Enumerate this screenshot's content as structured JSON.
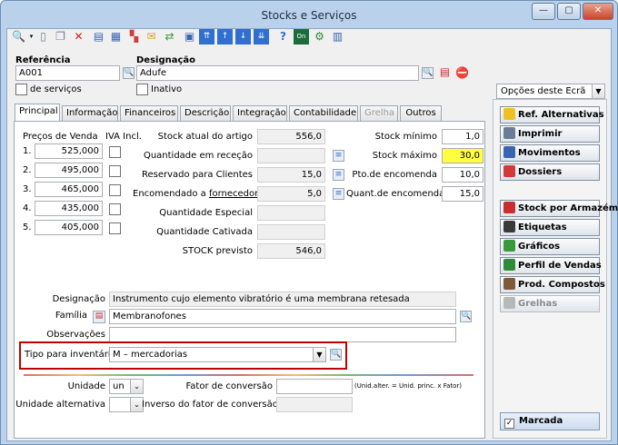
{
  "window": {
    "title": "Stocks e Serviços"
  },
  "header": {
    "ref_label": "Referência",
    "ref_value": "A001",
    "desig_label": "Designação",
    "desig_value": "Adufe",
    "servicos_label": "de serviços",
    "inativo_label": "Inativo"
  },
  "options_select": {
    "value": "Opções deste Ecrã"
  },
  "tabs": [
    {
      "label": "Principal"
    },
    {
      "label": "Informação"
    },
    {
      "label": "Financeiros"
    },
    {
      "label": "Descrição"
    },
    {
      "label": "Integração"
    },
    {
      "label": "Contabilidade"
    },
    {
      "label": "Grelha"
    },
    {
      "label": "Outros"
    }
  ],
  "prices": {
    "title": "Preços de Venda",
    "iva_label": "IVA Incl.",
    "rows": [
      {
        "n": "1.",
        "v": "525,000"
      },
      {
        "n": "2.",
        "v": "495,000"
      },
      {
        "n": "3.",
        "v": "465,000"
      },
      {
        "n": "4.",
        "v": "435,000"
      },
      {
        "n": "5.",
        "v": "405,000"
      }
    ]
  },
  "stock": {
    "atual": {
      "label": "Stock atual do artigo",
      "value": "556,0"
    },
    "rececao": {
      "label": "Quantidade em receção",
      "value": ""
    },
    "reservado": {
      "label": "Reservado para Clientes",
      "value": "15,0"
    },
    "encomendado": {
      "label": "Encomendado a",
      "link": "fornecedores",
      "value": "5,0"
    },
    "especial": {
      "label": "Quantidade Especial",
      "value": ""
    },
    "cativada": {
      "label": "Quantidade Cativada",
      "value": ""
    },
    "previsto": {
      "label": "STOCK previsto",
      "value": "546,0"
    },
    "minimo": {
      "label": "Stock mínimo",
      "value": "1,0"
    },
    "maximo": {
      "label": "Stock máximo",
      "value": "30,0"
    },
    "pto": {
      "label": "Pto.de encomenda",
      "value": "10,0"
    },
    "quant": {
      "label": "Quant.de encomenda",
      "value": "15,0"
    }
  },
  "details": {
    "designacao": {
      "label": "Designação",
      "value": "Instrumento cujo elemento vibratório é uma membrana retesada"
    },
    "familia": {
      "label": "Família",
      "value": "Membranofones"
    },
    "observacoes": {
      "label": "Observações",
      "value": ""
    },
    "tipo": {
      "label": "Tipo para inventário",
      "value": "M – mercadorias"
    },
    "unidade": {
      "label": "Unidade",
      "value": "un"
    },
    "fator": {
      "label": "Fator de conversão",
      "value": "",
      "hint": "(Unid.alter. = Unid. princ. x Fator)"
    },
    "unidade_alt": {
      "label": "Unidade alternativa",
      "value": ""
    },
    "inverso": {
      "label": "Inverso do fator de conversão",
      "value": ""
    }
  },
  "sidebar": {
    "buttons": [
      {
        "label": "Ref. Alternativas",
        "icon": "pencil-icon",
        "color": "#f0c020"
      },
      {
        "label": "Imprimir",
        "icon": "printer-icon",
        "color": "#6b7d94"
      },
      {
        "label": "Movimentos",
        "icon": "movements-icon",
        "color": "#3a64b0"
      },
      {
        "label": "Dossiers",
        "icon": "folder-icon",
        "color": "#d23a3a"
      }
    ],
    "buttons2": [
      {
        "label": "Stock por Armazém",
        "icon": "cube-icon",
        "color": "#c83030"
      },
      {
        "label": "Etiquetas",
        "icon": "label-icon",
        "color": "#3a3a3a"
      },
      {
        "label": "Gráficos",
        "icon": "chart-icon",
        "color": "#3a9a3a"
      },
      {
        "label": "Perfil de Vendas",
        "icon": "profile-icon",
        "color": "#2f8a3a"
      },
      {
        "label": "Prod. Compostos",
        "icon": "composite-icon",
        "color": "#7f5a3a"
      },
      {
        "label": "Grelhas",
        "icon": "grid-icon",
        "color": "#9a9a9a"
      }
    ],
    "marcada": "Marcada"
  },
  "colors": {
    "stock_max_bg": "#ffff40",
    "highlight_border": "#c00000"
  }
}
